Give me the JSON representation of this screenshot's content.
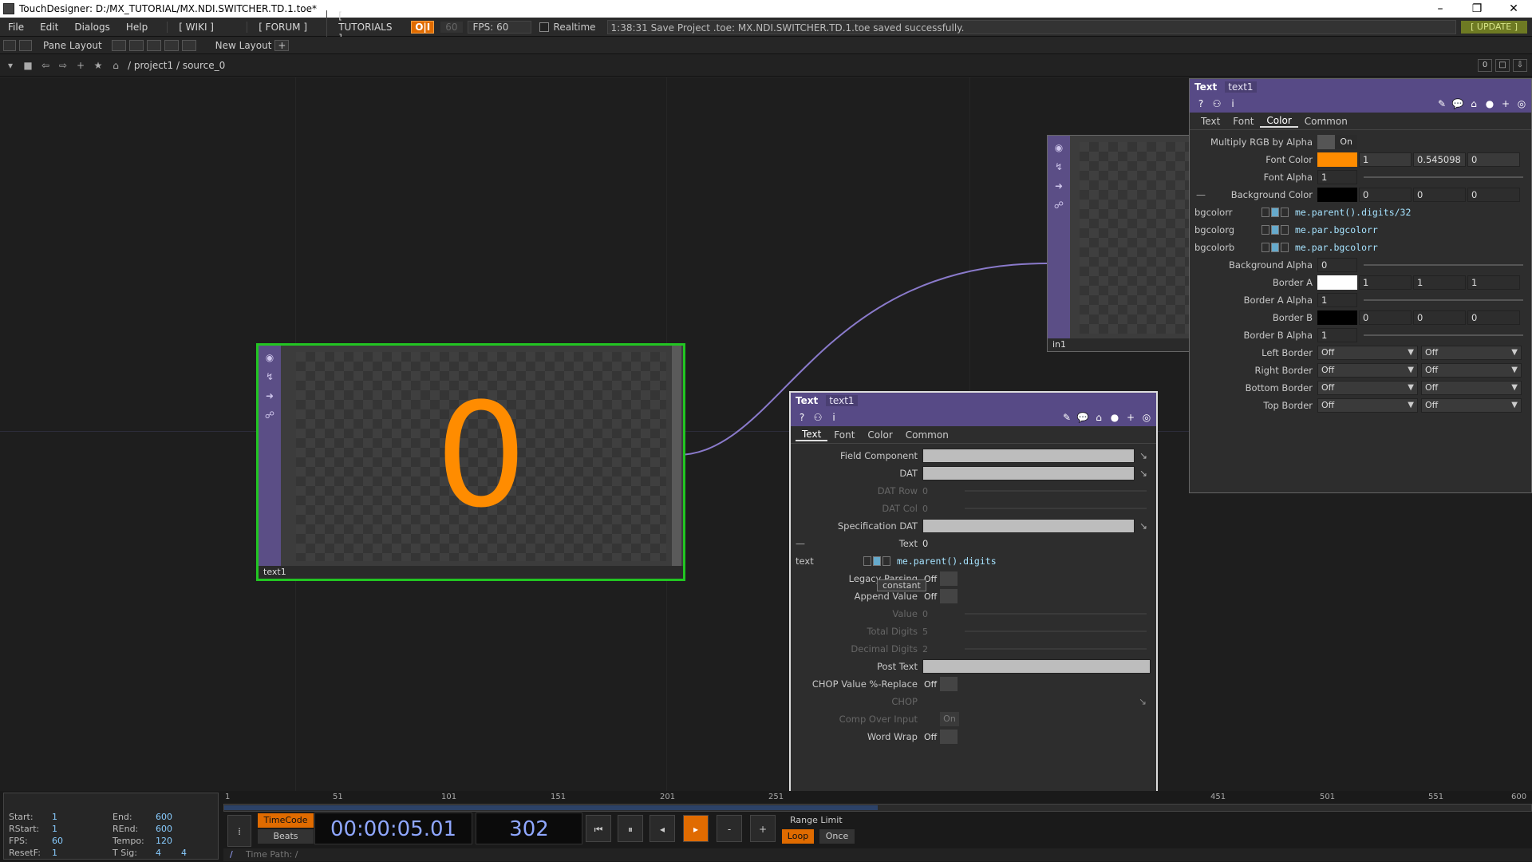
{
  "window": {
    "title": "TouchDesigner: D:/MX_TUTORIAL/MX.NDI.SWITCHER.TD.1.toe*",
    "minimize": "–",
    "restore": "❐",
    "close": "✕"
  },
  "menubar": {
    "items": [
      "File",
      "Edit",
      "Dialogs",
      "Help"
    ],
    "wiki": "[ WIKI ]",
    "forum": "[ FORUM ]",
    "tutorials": "[ TUTORIALS ]",
    "oi": "O|I",
    "fps_dim": "60",
    "fps": "FPS:  60",
    "realtime": "Realtime",
    "status": "1:38:31 Save Project .toe: MX.NDI.SWITCHER.TD.1.toe saved successfully.",
    "update": "[ UPDATE ]"
  },
  "panebar": {
    "pane_layout": "Pane Layout",
    "new_layout": "New Layout",
    "plus": "+"
  },
  "pathbar": {
    "path": "/ project1 / source_0",
    "zero": "0"
  },
  "nodes": {
    "text1": {
      "label": "text1",
      "display_value": "0",
      "digit_color": "#ff8c00"
    },
    "in1": {
      "label": "in1"
    }
  },
  "colors": {
    "accent": "#e06b00",
    "header": "#574a86",
    "node_select": "#22c522",
    "font_color": "#ff8c00"
  },
  "right_panel": {
    "op_type": "Text",
    "op_name": "text1",
    "tabs": [
      "Text",
      "Font",
      "Color",
      "Common"
    ],
    "active_tab": "Color",
    "rows": {
      "multiply_rgb": {
        "label": "Multiply RGB by Alpha",
        "value": "On"
      },
      "font_color": {
        "label": "Font Color",
        "v1": "1",
        "v2": "0.545098",
        "v3": "0"
      },
      "font_alpha": {
        "label": "Font Alpha",
        "value": "1"
      },
      "background_color": {
        "label": "Background Color",
        "v1": "0",
        "v2": "0",
        "v3": "0"
      },
      "bgcolorr": {
        "label": "bgcolorr",
        "expr": "me.parent().digits/32"
      },
      "bgcolorg": {
        "label": "bgcolorg",
        "expr": "me.par.bgcolorr"
      },
      "bgcolorb": {
        "label": "bgcolorb",
        "expr": "me.par.bgcolorr"
      },
      "background_alpha": {
        "label": "Background Alpha",
        "value": "0"
      },
      "border_a": {
        "label": "Border A",
        "v1": "1",
        "v2": "1",
        "v3": "1"
      },
      "border_a_alpha": {
        "label": "Border A Alpha",
        "value": "1"
      },
      "border_b": {
        "label": "Border B",
        "v1": "0",
        "v2": "0",
        "v3": "0"
      },
      "border_b_alpha": {
        "label": "Border B Alpha",
        "value": "1"
      },
      "left_border": {
        "label": "Left Border",
        "v1": "Off",
        "v2": "Off"
      },
      "right_border": {
        "label": "Right Border",
        "v1": "Off",
        "v2": "Off"
      },
      "bottom_border": {
        "label": "Bottom Border",
        "v1": "Off",
        "v2": "Off"
      },
      "top_border": {
        "label": "Top Border",
        "v1": "Off",
        "v2": "Off"
      }
    }
  },
  "float_panel": {
    "op_type": "Text",
    "op_name": "text1",
    "tabs": [
      "Text",
      "Font",
      "Color",
      "Common"
    ],
    "active_tab": "Text",
    "rows": {
      "field_component": {
        "label": "Field Component"
      },
      "dat": {
        "label": "DAT"
      },
      "dat_row": {
        "label": "DAT Row",
        "value": "0"
      },
      "dat_col": {
        "label": "DAT Col",
        "value": "0"
      },
      "spec_dat": {
        "label": "Specification DAT"
      },
      "text": {
        "label": "Text",
        "value": "0"
      },
      "text_expr": {
        "label": "text",
        "expr": "me.parent().digits"
      },
      "legacy": {
        "label": "Legacy Parsing",
        "value": "Off",
        "tooltip": "constant"
      },
      "append": {
        "label": "Append Value",
        "value": "Off"
      },
      "value": {
        "label": "Value",
        "value": "0"
      },
      "total_digits": {
        "label": "Total Digits",
        "value": "5"
      },
      "decimal_digits": {
        "label": "Decimal Digits",
        "value": "2"
      },
      "post_text": {
        "label": "Post Text"
      },
      "chop_replace": {
        "label": "CHOP Value %-Replace",
        "value": "Off"
      },
      "chop": {
        "label": "CHOP"
      },
      "comp_over": {
        "label": "Comp Over Input",
        "value": "On"
      },
      "word_wrap": {
        "label": "Word Wrap",
        "value": "Off"
      }
    }
  },
  "timeline": {
    "info": {
      "start_lbl": "Start:",
      "start": "1",
      "end_lbl": "End:",
      "end": "600",
      "rstart_lbl": "RStart:",
      "rstart": "1",
      "rend_lbl": "REnd:",
      "rend": "600",
      "fps_lbl": "FPS:",
      "fps": "60",
      "tempo_lbl": "Tempo:",
      "tempo": "120",
      "resetf_lbl": "ResetF:",
      "resetf": "1",
      "tsig_lbl": "T Sig:",
      "tsig1": "4",
      "tsig2": "4"
    },
    "ticks": [
      "1",
      "51",
      "101",
      "151",
      "201",
      "251",
      "451",
      "501",
      "551",
      "600"
    ],
    "progress": 0.5,
    "timecode_btn": "TimeCode",
    "beats_btn": "Beats",
    "timecode": "00:00:05.01",
    "frame": "302",
    "range_limit": "Range Limit",
    "loop": "Loop",
    "once": "Once",
    "time_path": "Time Path: /",
    "sep": "/"
  }
}
